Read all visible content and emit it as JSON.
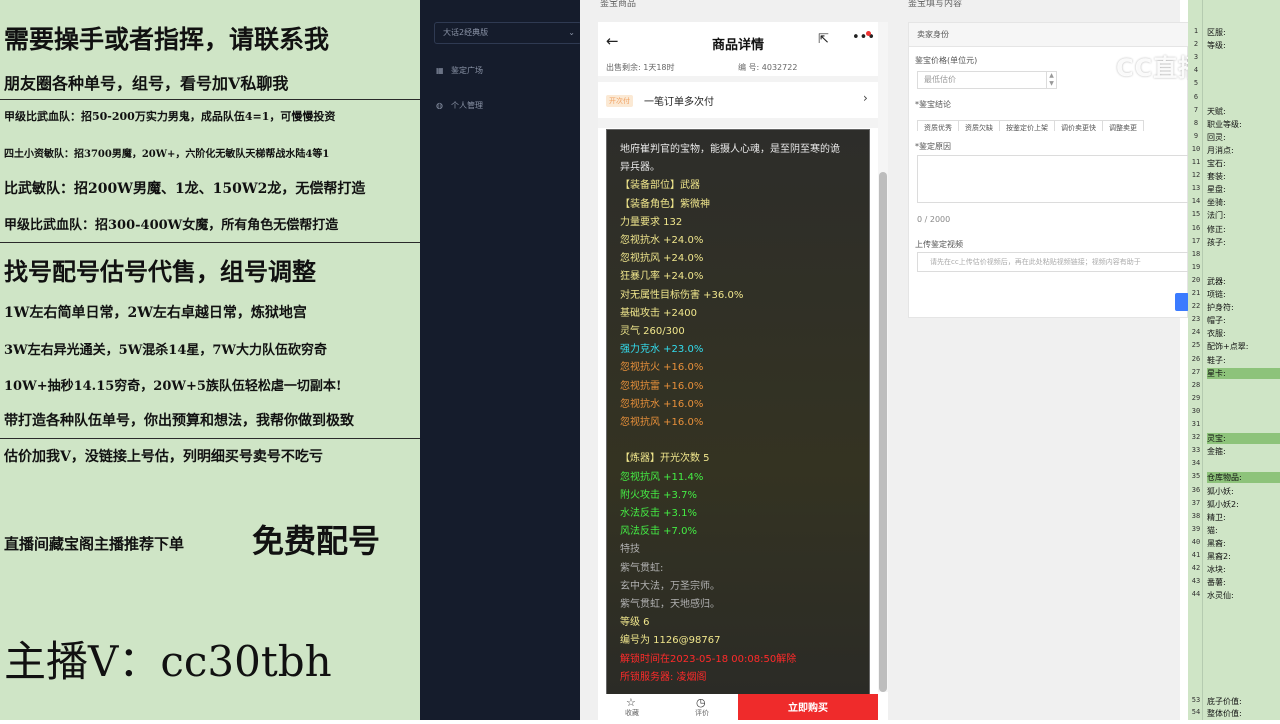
{
  "left_overlay": {
    "lines": [
      "需要操手或者指挥，请联系我",
      "朋友圈各种单号，组号，看号加V私聊我",
      "甲级比武血队：招50-200万实力男鬼，成品队伍4=1，可慢慢投资",
      "四土小资敏队：招3700男魔，20W+，六阶化无敏队天梯帮战水陆4等1",
      "比武敏队：招200W男魔、1龙、150W2龙，无偿帮打造",
      "甲级比武血队：招300-400W女魔，所有角色无偿帮打造",
      "找号配号估号代售，组号调整",
      "1W左右简单日常，2W左右卓越日常，炼狱地宫",
      "3W左右异光通关，5W混杀14星，7W大力队伍砍穷奇",
      "10W+抽秒14.15穷奇，20W+5族队伍轻松虐一切副本!",
      "带打造各种队伍单号，你出预算和想法，我帮你做到极致",
      "估价加我V，没链接上号估，列明细买号卖号不吃亏",
      "直播间藏宝阁主播推荐下单",
      "免费配号",
      "主播V：cc30tbh"
    ]
  },
  "sidebar": {
    "version_select": "大话2经典版",
    "items": [
      {
        "label": "鉴定广场",
        "icon": "square-grid-icon"
      },
      {
        "label": "个人管理",
        "icon": "person-icon"
      }
    ]
  },
  "panel_labels": {
    "left": "鉴宝商品",
    "right": "鉴宝填写内容"
  },
  "phone": {
    "header_title": "商品详情",
    "meta_time": "出售剩余: 1天18时",
    "meta_id": "编 号: 4032722",
    "order_tag": "开次付",
    "order_text": "一笔订单多次付",
    "card_lines": [
      {
        "text": "地府崔判官的宝物，能摄人心魂，是至阴至寒的诡",
        "color": "#e8e8e8"
      },
      {
        "text": "异兵器。",
        "color": "#e8e8e8"
      },
      {
        "text": "【装备部位】武器",
        "color": "#f0e68c"
      },
      {
        "text": "【装备角色】紫微神",
        "color": "#f0e68c"
      },
      {
        "text": "力量要求 132",
        "color": "#f0e68c"
      },
      {
        "text": "忽视抗水 +24.0%",
        "color": "#f0e68c"
      },
      {
        "text": "忽视抗风 +24.0%",
        "color": "#f0e68c"
      },
      {
        "text": "狂暴几率 +24.0%",
        "color": "#f0e68c"
      },
      {
        "text": "对无属性目标伤害 +36.0%",
        "color": "#f0e68c"
      },
      {
        "text": "基础攻击 +2400",
        "color": "#f0e68c"
      },
      {
        "text": "灵气 260/300",
        "color": "#f0e68c"
      },
      {
        "text": "强力克水 +23.0%",
        "color": "#33ddee"
      },
      {
        "text": "忽视抗火 +16.0%",
        "color": "#e8903a"
      },
      {
        "text": "忽视抗雷 +16.0%",
        "color": "#e8903a"
      },
      {
        "text": "忽视抗水 +16.0%",
        "color": "#e8903a"
      },
      {
        "text": "忽视抗风 +16.0%",
        "color": "#e8903a"
      },
      {
        "text": "",
        "color": "#e8e8e8"
      },
      {
        "text": "【炼器】开光次数 5",
        "color": "#f0e68c"
      },
      {
        "text": "忽视抗风 +11.4%",
        "color": "#44ee44"
      },
      {
        "text": "附火攻击 +3.7%",
        "color": "#44ee44"
      },
      {
        "text": "水法反击 +3.1%",
        "color": "#44ee44"
      },
      {
        "text": "风法反击 +7.0%",
        "color": "#44ee44"
      },
      {
        "text": "特技",
        "color": "#b0b0b0"
      },
      {
        "text": "紫气贯虹:",
        "color": "#b0b0b0"
      },
      {
        "text": "玄中大法，万圣宗师。",
        "color": "#b0b0b0"
      },
      {
        "text": "紫气贯虹，天地感归。",
        "color": "#b0b0b0"
      },
      {
        "text": "等级 6",
        "color": "#f0e68c"
      },
      {
        "text": "编号为 1126@98767",
        "color": "#f0e68c"
      },
      {
        "text": "解锁时间在2023-05-18 00:08:50解除",
        "color": "#ff2a2a"
      },
      {
        "text": "所锁服务器: 凌烟阁",
        "color": "#ff2a2a"
      }
    ],
    "footer": {
      "fav_label": "收藏",
      "consult_label": "评价",
      "buy_label": "立即购买"
    }
  },
  "form": {
    "seller_label": "卖家身份",
    "price_label": "鉴宝价格(单位元)",
    "price_placeholder": "最低估价",
    "conclusion_label": "*鉴宝结论",
    "chips": [
      "资质优秀",
      "资质欠缺",
      "按鉴定价上架",
      "调价卖更快",
      "调整卖更"
    ],
    "reason_label": "*鉴定原因",
    "counter": "0 / 2000",
    "video_label": "上传鉴定视频",
    "video_placeholder": "请先在cc上传估价视频后，再在此处粘贴视频链接；视频内容有助于"
  },
  "watermark": "CC直播",
  "right_panel": {
    "rows": [
      {
        "num": "1",
        "label": "区服:",
        "hl": false
      },
      {
        "num": "2",
        "label": "等级:",
        "hl": false
      },
      {
        "num": "3",
        "label": "",
        "hl": false
      },
      {
        "num": "4",
        "label": "",
        "hl": false
      },
      {
        "num": "5",
        "label": "",
        "hl": false
      },
      {
        "num": "6",
        "label": "",
        "hl": false
      },
      {
        "num": "7",
        "label": "天赋:",
        "hl": false
      },
      {
        "num": "8",
        "label": "职业等级:",
        "hl": false
      },
      {
        "num": "9",
        "label": "回灵:",
        "hl": false
      },
      {
        "num": "10",
        "label": "月消点:",
        "hl": false
      },
      {
        "num": "11",
        "label": "宝石:",
        "hl": false
      },
      {
        "num": "12",
        "label": "套装:",
        "hl": false
      },
      {
        "num": "13",
        "label": "星盘:",
        "hl": false
      },
      {
        "num": "14",
        "label": "坐骑:",
        "hl": false
      },
      {
        "num": "15",
        "label": "法门:",
        "hl": false
      },
      {
        "num": "16",
        "label": "修正:",
        "hl": false
      },
      {
        "num": "17",
        "label": "孩子:",
        "hl": false
      },
      {
        "num": "18",
        "label": "",
        "hl": false
      },
      {
        "num": "19",
        "label": "",
        "hl": false
      },
      {
        "num": "20",
        "label": "武器:",
        "hl": false
      },
      {
        "num": "21",
        "label": "项链:",
        "hl": false
      },
      {
        "num": "22",
        "label": "护身符:",
        "hl": false
      },
      {
        "num": "23",
        "label": "帽子:",
        "hl": false
      },
      {
        "num": "24",
        "label": "衣服:",
        "hl": false
      },
      {
        "num": "25",
        "label": "配饰+点翠:",
        "hl": false
      },
      {
        "num": "26",
        "label": "鞋子:",
        "hl": false
      },
      {
        "num": "27",
        "label": "星卡:",
        "hl": true
      },
      {
        "num": "28",
        "label": "",
        "hl": false
      },
      {
        "num": "29",
        "label": "",
        "hl": false
      },
      {
        "num": "30",
        "label": "",
        "hl": false
      },
      {
        "num": "31",
        "label": "",
        "hl": false
      },
      {
        "num": "32",
        "label": "灵宝:",
        "hl": true
      },
      {
        "num": "33",
        "label": "金箍:",
        "hl": false
      },
      {
        "num": "34",
        "label": "",
        "hl": false
      },
      {
        "num": "35",
        "label": "仓库物品:",
        "hl": true
      },
      {
        "num": "36",
        "label": "狐小妖:",
        "hl": false
      },
      {
        "num": "37",
        "label": "狐小妖2:",
        "hl": false
      },
      {
        "num": "38",
        "label": "精卫:",
        "hl": false
      },
      {
        "num": "39",
        "label": "猫:",
        "hl": false
      },
      {
        "num": "40",
        "label": "黑裔:",
        "hl": false
      },
      {
        "num": "41",
        "label": "黑裔2:",
        "hl": false
      },
      {
        "num": "42",
        "label": "冰块:",
        "hl": false
      },
      {
        "num": "43",
        "label": "番薯:",
        "hl": false
      },
      {
        "num": "44",
        "label": "水灵仙:",
        "hl": false
      },
      {
        "num": "53",
        "label": "底子价值:",
        "hl": false
      },
      {
        "num": "54",
        "label": "整体价值:",
        "hl": false
      }
    ]
  }
}
